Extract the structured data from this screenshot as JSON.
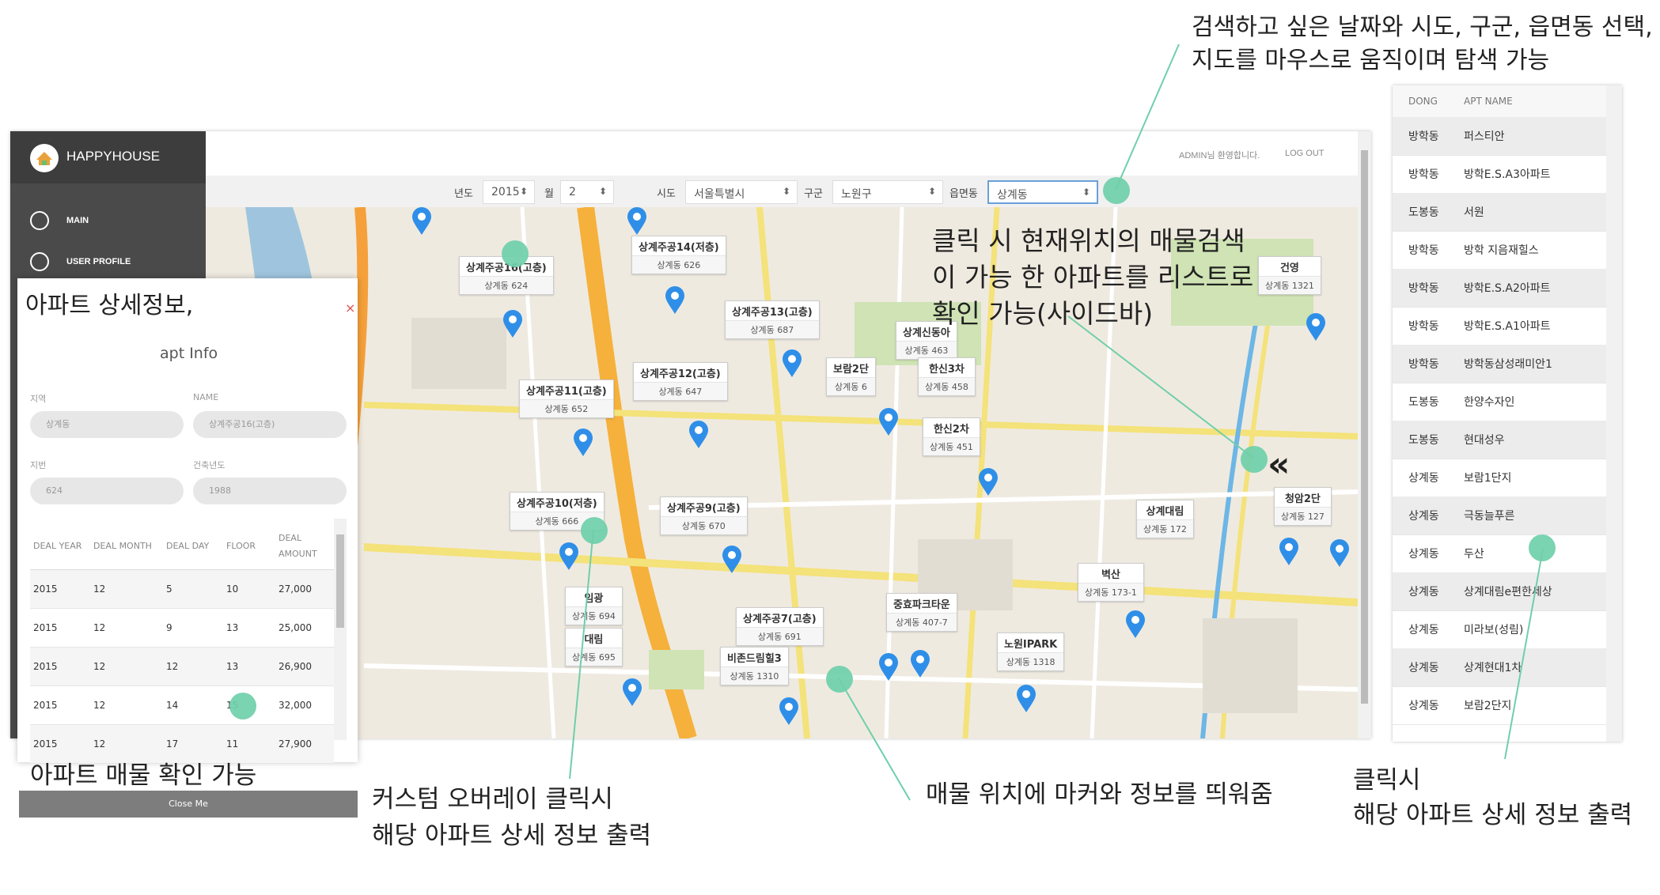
{
  "app": {
    "brand": "HAPPYHOUSE",
    "nav": [
      {
        "label": "MAIN",
        "icon": "dashboard-icon"
      },
      {
        "label": "USER PROFILE",
        "icon": "user-icon"
      }
    ],
    "welcome": "ADMIN님 환영합니다.",
    "logout": "LOG OUT"
  },
  "filters": {
    "year_label": "년도",
    "year_value": "2015",
    "month_label": "월",
    "month_value": "2",
    "sido_label": "시도",
    "sido_value": "서울특별시",
    "gugun_label": "구군",
    "gugun_value": "노원구",
    "dong_label": "읍면동",
    "dong_value": "상계동"
  },
  "map": {
    "overlays": [
      {
        "name": "상계주공16(고층)",
        "sub": "상계동 624"
      },
      {
        "name": "상계주공14(저층)",
        "sub": "상계동 626"
      },
      {
        "name": "상계주공13(고층)",
        "sub": "상계동 687"
      },
      {
        "name": "상계주공12(고층)",
        "sub": "상계동 647"
      },
      {
        "name": "상계주공11(고층)",
        "sub": "상계동 652"
      },
      {
        "name": "상계신동아",
        "sub": "상계동 463"
      },
      {
        "name": "보람2단",
        "sub": "상계동 6"
      },
      {
        "name": "한신3차",
        "sub": "상계동 458"
      },
      {
        "name": "한신2차",
        "sub": "상계동 451"
      },
      {
        "name": "건영",
        "sub": "상계동 1321"
      },
      {
        "name": "상계주공10(저층)",
        "sub": "상계동 666"
      },
      {
        "name": "상계주공9(고층)",
        "sub": "상계동 670"
      },
      {
        "name": "상계대림",
        "sub": "상계동 172"
      },
      {
        "name": "청암2단",
        "sub": "상계동 127"
      },
      {
        "name": "벽산",
        "sub": "상계동 173-1"
      },
      {
        "name": "임광",
        "sub": "상계동 694"
      },
      {
        "name": "대림",
        "sub": "상계동 695"
      },
      {
        "name": "상계주공7(고층)",
        "sub": "상계동 691"
      },
      {
        "name": "중효파크타운",
        "sub": "상계동 407-7"
      },
      {
        "name": "비존드림힐3",
        "sub": "상계동 1310"
      },
      {
        "name": "노원IPARK",
        "sub": "상계동 1318"
      }
    ]
  },
  "detail": {
    "heading": "apt Info",
    "region_label": "지역",
    "region_value": "상계동",
    "name_label": "NAME",
    "name_value": "상계주공16(고층)",
    "jibun_label": "지번",
    "jibun_value": "624",
    "year_label": "건축년도",
    "year_value": "1988",
    "columns": [
      "DEAL YEAR",
      "DEAL MONTH",
      "DEAL DAY",
      "FLOOR",
      "DEAL AMOUNT"
    ],
    "rows": [
      [
        "2015",
        "12",
        "5",
        "10",
        "27,000"
      ],
      [
        "2015",
        "12",
        "9",
        "13",
        "25,000"
      ],
      [
        "2015",
        "12",
        "12",
        "13",
        "26,900"
      ],
      [
        "2015",
        "12",
        "14",
        "15",
        "32,000"
      ],
      [
        "2015",
        "12",
        "17",
        "11",
        "27,900"
      ]
    ],
    "close": "Close Me"
  },
  "apt_list": {
    "col_dong": "DONG",
    "col_name": "APT NAME",
    "rows": [
      {
        "dong": "방학동",
        "name": "퍼스티안"
      },
      {
        "dong": "방학동",
        "name": "방학E.S.A3아파트"
      },
      {
        "dong": "도봉동",
        "name": "서원"
      },
      {
        "dong": "방학동",
        "name": "방학 지음재힐스"
      },
      {
        "dong": "방학동",
        "name": "방학E.S.A2아파트"
      },
      {
        "dong": "방학동",
        "name": "방학E.S.A1아파트"
      },
      {
        "dong": "방학동",
        "name": "방학동삼성래미안1"
      },
      {
        "dong": "도봉동",
        "name": "한양수자인"
      },
      {
        "dong": "도봉동",
        "name": "현대성우"
      },
      {
        "dong": "상계동",
        "name": "보람1단지"
      },
      {
        "dong": "상계동",
        "name": "극동늘푸른"
      },
      {
        "dong": "상계동",
        "name": "두산"
      },
      {
        "dong": "상계동",
        "name": "상계대림e편한세상"
      },
      {
        "dong": "상계동",
        "name": "미라보(성림)"
      },
      {
        "dong": "상계동",
        "name": "상계현대1차"
      },
      {
        "dong": "상계동",
        "name": "보람2단지"
      }
    ]
  },
  "annotations": {
    "top_right_1": "검색하고 싶은  날짜와 시도, 구군, 읍면동 선택,",
    "top_right_2": "지도를 마우스로 움직이며 탐색 가능",
    "detail_title": "아파트 상세정보,",
    "map_click_1": "클릭 시  현재위치의  매물검색",
    "map_click_2": "이 가능  한 아파트를  리스트로",
    "map_click_3": "확인 가능(사이드바)",
    "deal_check": "아파트 매물  확인 가능",
    "overlay_1": "커스텀 오버레이 클릭시",
    "overlay_2": "해당 아파트 상세 정보 출력",
    "marker_info": "매물 위치에 마커와 정보를 띄워줌",
    "list_click_1": "클릭시",
    "list_click_2": "해당 아파트 상세 정보 출력"
  },
  "colors": {
    "sidebar": "#4a4a4a",
    "marker": "#2f8fe8",
    "annotation_dot": "#6fcfaa",
    "road_major": "#f5b13b",
    "road_minor": "#f4e27a",
    "river": "#9fc5de"
  }
}
